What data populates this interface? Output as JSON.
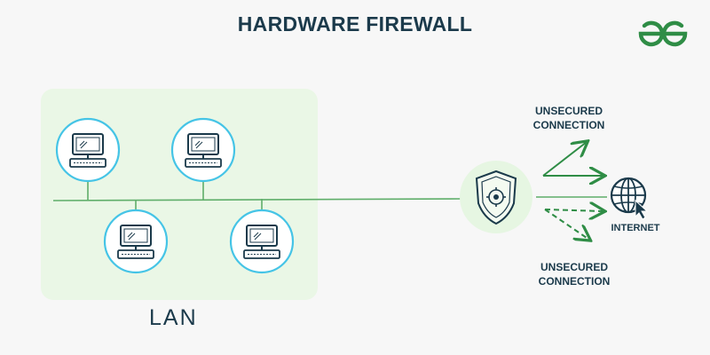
{
  "title": "HARDWARE FIREWALL",
  "logo": {
    "icon": "geeksforgeeks-logo-icon",
    "color": "#2f8d46"
  },
  "lan": {
    "label": "LAN"
  },
  "connections": {
    "top_label_line1": "UNSECURED",
    "top_label_line2": "CONNECTION",
    "bottom_label_line1": "UNSECURED",
    "bottom_label_line2": "CONNECTION"
  },
  "internet": {
    "label": "INTERNET",
    "icon": "globe-icon"
  },
  "firewall": {
    "icon": "shield-icon"
  },
  "computers": [
    {
      "icon": "desktop-computer-icon"
    },
    {
      "icon": "desktop-computer-icon"
    },
    {
      "icon": "desktop-computer-icon"
    },
    {
      "icon": "desktop-computer-icon"
    }
  ],
  "colors": {
    "text": "#1b3a4b",
    "accent_green": "#2f8d46",
    "circle_border": "#45c4e6",
    "lan_bg": "#eaf7e6",
    "line": "#5fae6a"
  }
}
